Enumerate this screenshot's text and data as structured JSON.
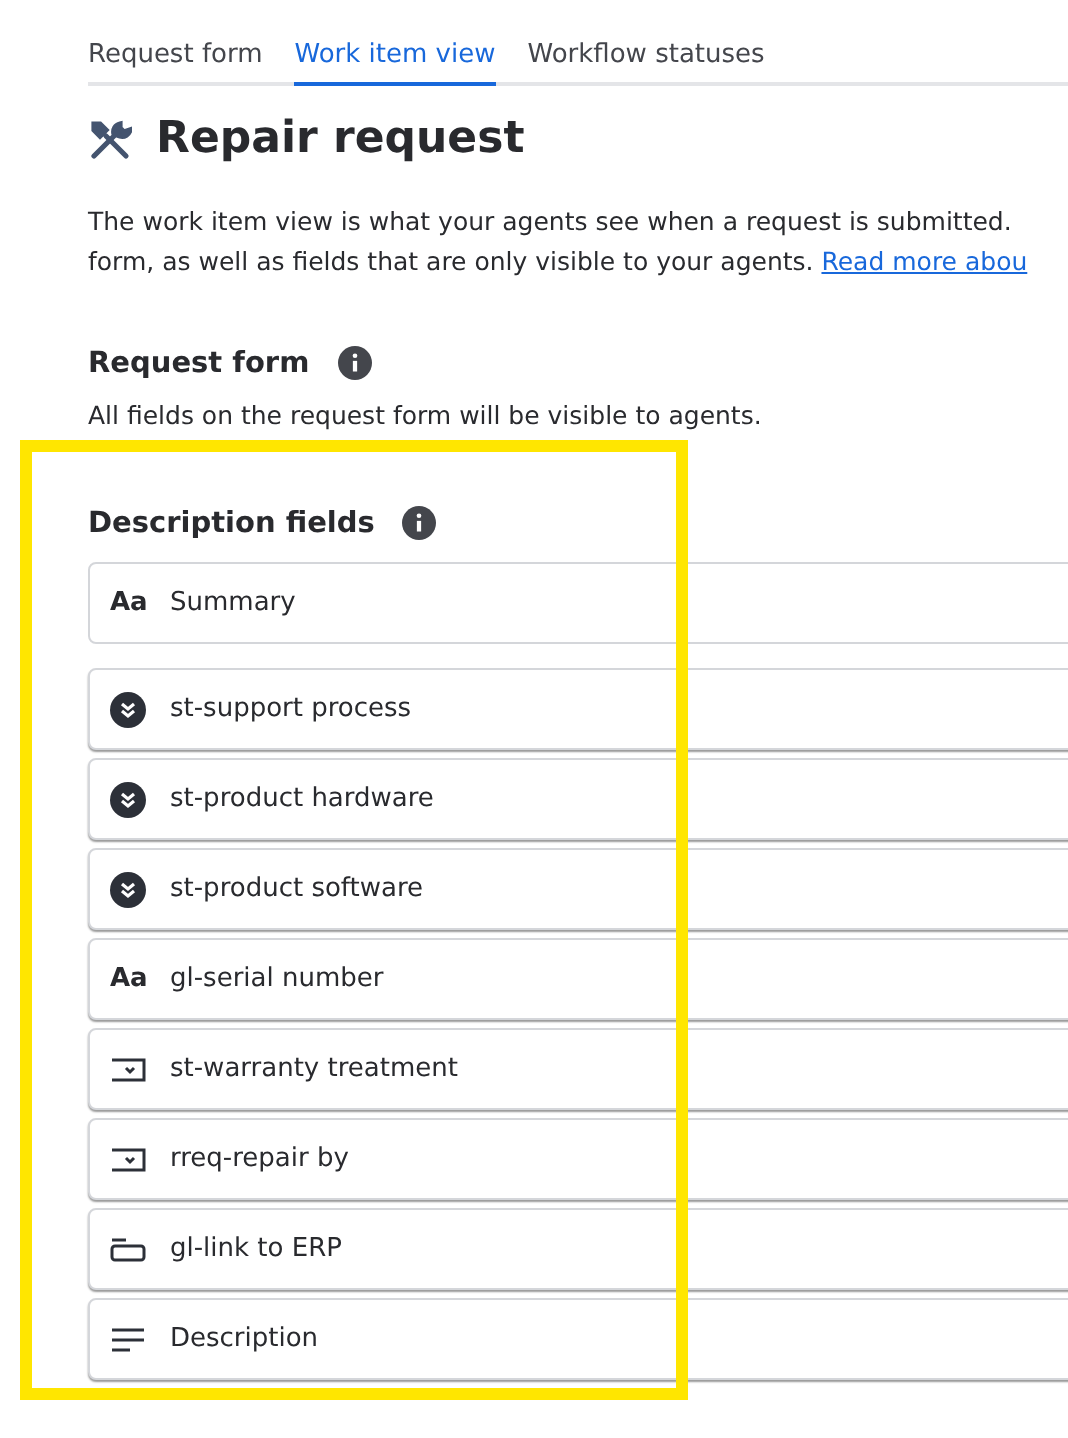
{
  "tabs": [
    {
      "label": "Request form",
      "selected": false
    },
    {
      "label": "Work item view",
      "selected": true
    },
    {
      "label": "Workflow statuses",
      "selected": false
    }
  ],
  "title": "Repair request",
  "intro": {
    "line_1": "The work item view is what your agents see when a request is submitted.",
    "line_2": "form, as well as fields that are only visible to your agents.",
    "link": "Read more abou"
  },
  "request_form": {
    "heading": "Request form",
    "text": "All fields on the request form will be visible to agents."
  },
  "description_fields": {
    "heading": "Description fields",
    "highlighted": true,
    "summary": {
      "kind": "text",
      "icon_label": "Aa",
      "label": "Summary"
    },
    "fields": [
      {
        "kind": "select",
        "label": "st-support process"
      },
      {
        "kind": "select",
        "label": "st-product hardware"
      },
      {
        "kind": "select",
        "label": "st-product software"
      },
      {
        "kind": "text",
        "icon_label": "Aa",
        "label": "gl-serial number"
      },
      {
        "kind": "dropdown",
        "label": "st-warranty treatment"
      },
      {
        "kind": "dropdown",
        "label": "rreq-repair by"
      },
      {
        "kind": "link",
        "label": "gl-link to ERP"
      },
      {
        "kind": "paragraph",
        "label": "Description"
      }
    ]
  }
}
